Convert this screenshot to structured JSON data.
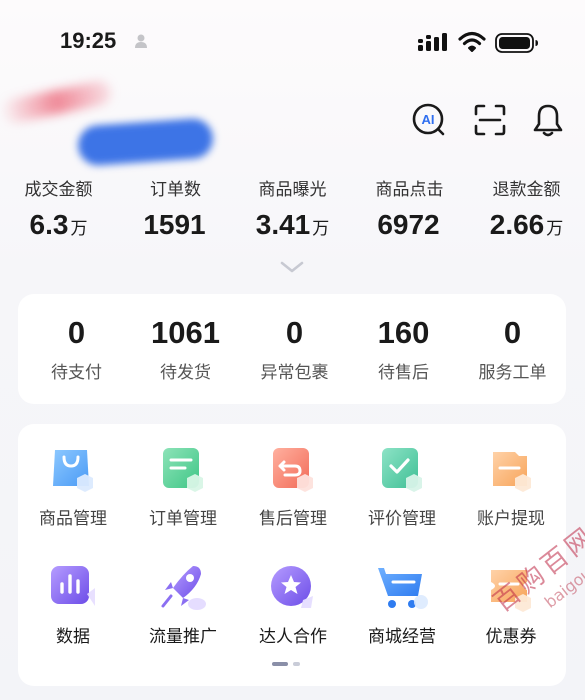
{
  "status_bar": {
    "time": "19:25",
    "icons": [
      "person-icon",
      "cellular-signal-icon",
      "wifi-icon",
      "battery-icon"
    ]
  },
  "header": {
    "icons": [
      "ai-assistant-icon",
      "scan-icon",
      "bell-icon"
    ],
    "ai_label": "AI"
  },
  "metrics": [
    {
      "label": "成交金额",
      "value": "6.3",
      "unit": "万"
    },
    {
      "label": "订单数",
      "value": "1591",
      "unit": ""
    },
    {
      "label": "商品曝光",
      "value": "3.41",
      "unit": "万"
    },
    {
      "label": "商品点击",
      "value": "6972",
      "unit": ""
    },
    {
      "label": "退款金额",
      "value": "2.66",
      "unit": "万"
    }
  ],
  "orders": [
    {
      "count": "0",
      "label": "待支付"
    },
    {
      "count": "1061",
      "label": "待发货"
    },
    {
      "count": "0",
      "label": "异常包裹"
    },
    {
      "count": "160",
      "label": "待售后"
    },
    {
      "count": "0",
      "label": "服务工单"
    }
  ],
  "tools": {
    "row1": [
      {
        "label": "商品管理",
        "icon": "product-bag-icon",
        "color": "#5aa9f7"
      },
      {
        "label": "订单管理",
        "icon": "order-doc-icon",
        "color": "#4cc98e"
      },
      {
        "label": "售后管理",
        "icon": "after-sale-return-icon",
        "color": "#f57c6a"
      },
      {
        "label": "评价管理",
        "icon": "review-check-icon",
        "color": "#4fc9a2"
      },
      {
        "label": "账户提现",
        "icon": "wallet-withdraw-icon",
        "color": "#f7a45a"
      }
    ],
    "row2": [
      {
        "label": "数据",
        "icon": "data-chart-icon",
        "color": "#7b5cf0"
      },
      {
        "label": "流量推广",
        "icon": "rocket-icon",
        "color": "#7b5cf0"
      },
      {
        "label": "达人合作",
        "icon": "star-badge-icon",
        "color": "#7b5cf0"
      },
      {
        "label": "商城经营",
        "icon": "shopping-cart-icon",
        "color": "#3d8cf5"
      },
      {
        "label": "优惠券",
        "icon": "coupon-icon",
        "color": "#f7a45a"
      }
    ]
  },
  "watermark": {
    "main": "百购百网",
    "url": "baigou.net"
  }
}
